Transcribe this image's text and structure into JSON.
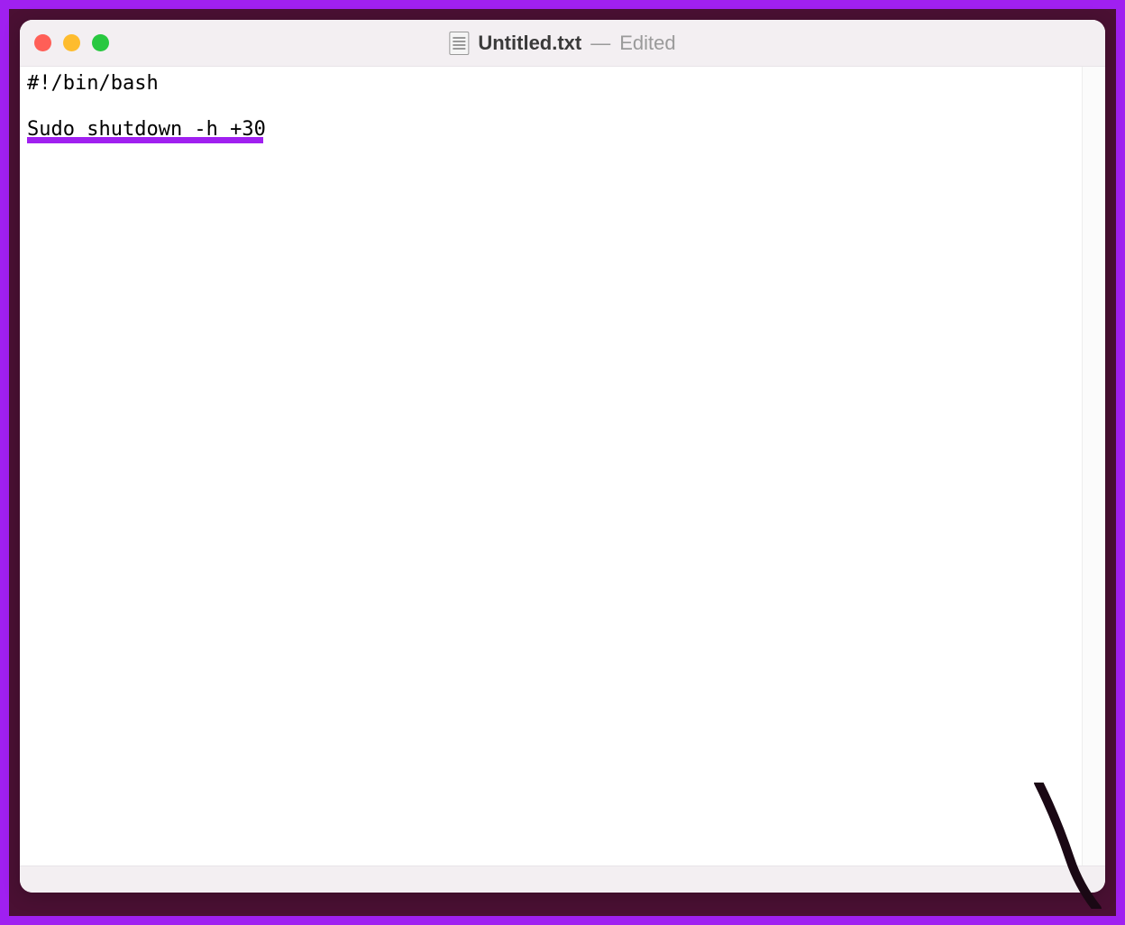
{
  "window": {
    "filename": "Untitled.txt",
    "separator": "—",
    "status": "Edited"
  },
  "traffic_lights": {
    "close": "close",
    "minimize": "minimize",
    "maximize": "maximize"
  },
  "editor": {
    "lines": [
      "#!/bin/bash",
      "",
      "Sudo shutdown -h +30"
    ],
    "content": "#!/bin/bash\n\nSudo shutdown -h +30",
    "highlighted_line": "Sudo shutdown -h +30"
  },
  "decoration": {
    "underline_color": "#a020f0"
  }
}
